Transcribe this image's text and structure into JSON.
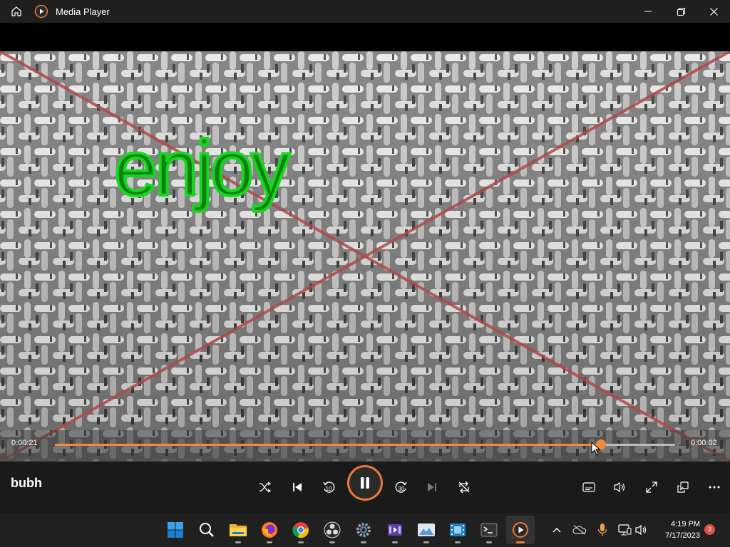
{
  "window": {
    "title": "Media Player",
    "icons": [
      "home-icon",
      "media-player-icon",
      "minimize-icon",
      "restore-icon",
      "close-icon"
    ]
  },
  "video": {
    "overlay_text": "enjoy",
    "colors": {
      "text_fill": "#0f7f12",
      "text_outline": "#15d81e",
      "cross_lines": "#b04848"
    }
  },
  "playback": {
    "elapsed": "0:00:21",
    "remaining": "0:00:02",
    "progress": 0.88,
    "accent_color": "#f08a3a"
  },
  "now_playing": {
    "title": "bubh"
  },
  "controls": {
    "center": [
      "shuffle-icon",
      "previous-icon",
      "skip-back-10-icon",
      "pause-icon",
      "skip-forward-30-icon",
      "next-icon",
      "repeat-icon"
    ],
    "skip_back_label": "10",
    "skip_forward_label": "30",
    "right": [
      "captions-icon",
      "volume-icon",
      "fullscreen-icon",
      "mini-player-icon",
      "more-icon"
    ]
  },
  "taskbar": {
    "apps": [
      "windows-start-icon",
      "search-icon",
      "file-explorer-icon",
      "firefox-icon",
      "chrome-icon",
      "obs-icon",
      "settings-icon",
      "video-editor-icon",
      "photos-icon",
      "movies-icon",
      "terminal-icon",
      "media-player-icon"
    ],
    "tray": [
      "show-hidden-icons-icon",
      "onedrive-icon",
      "microphone-icon",
      "network-icon",
      "volume-icon"
    ],
    "time": "4:19 PM",
    "date": "7/17/2023",
    "notification_count": "3"
  }
}
